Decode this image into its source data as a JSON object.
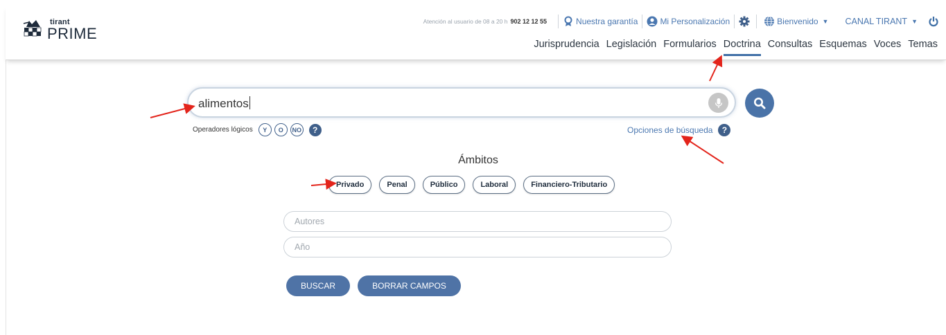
{
  "logo": {
    "small": "tirant",
    "big": "PRIME"
  },
  "topbar": {
    "attention": "Atención al usuario de 08 a 20 h",
    "phone": "902 12 12 55",
    "guarantee": "Nuestra garantía",
    "personalization": "Mi Personalización",
    "welcome": "Bienvenido",
    "channel": "CANAL TIRANT"
  },
  "nav": {
    "items": [
      "Jurisprudencia",
      "Legislación",
      "Formularios",
      "Doctrina",
      "Consultas",
      "Esquemas",
      "Voces",
      "Temas"
    ],
    "active": "Doctrina"
  },
  "search": {
    "value": "alimentos",
    "operators_label": "Operadores lógicos",
    "operators": [
      "Y",
      "O",
      "NO"
    ],
    "options_label": "Opciones de búsqueda"
  },
  "ambitos": {
    "title": "Ámbitos",
    "chips": [
      "Privado",
      "Penal",
      "Público",
      "Laboral",
      "Financiero-Tributario"
    ]
  },
  "fields": {
    "autores_placeholder": "Autores",
    "anio_placeholder": "Año"
  },
  "buttons": {
    "buscar": "BUSCAR",
    "borrar": "BORRAR CAMPOS"
  },
  "colors": {
    "accent": "#4a73a8",
    "link": "#4a77b0",
    "annotation": "#e3241b"
  }
}
